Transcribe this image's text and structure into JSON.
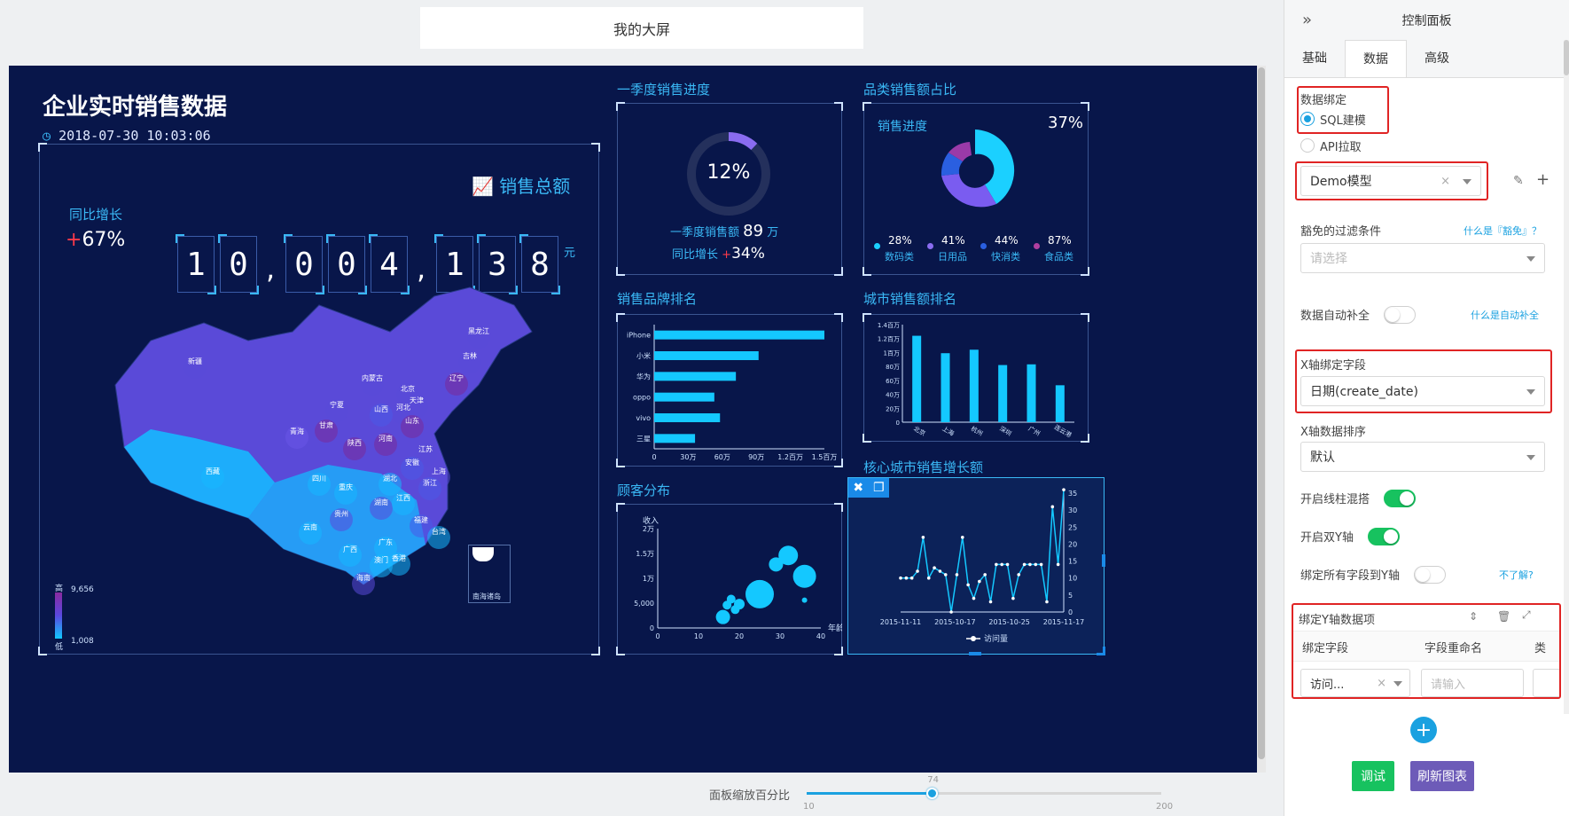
{
  "page_title": "我的大屏",
  "dashboard": {
    "title": "企业实时销售数据",
    "datetime": "2018-07-30 10:03:06",
    "sales_total": {
      "label": "销售总额",
      "yoy_label": "同比增长",
      "yoy_sign": "+",
      "yoy_value": "67%",
      "digits": [
        "1",
        "0",
        ",",
        "0",
        "0",
        "4",
        ",",
        "1",
        "3",
        "8"
      ],
      "unit": "元"
    },
    "map": {
      "provinces": [
        "新疆",
        "西藏",
        "青海",
        "甘肃",
        "内蒙古",
        "黑龙江",
        "吉林",
        "辽宁",
        "北京",
        "天津",
        "河北",
        "山西",
        "陕西",
        "宁夏",
        "山东",
        "河南",
        "江苏",
        "安徽",
        "上海",
        "浙江",
        "湖北",
        "四川",
        "重庆",
        "贵州",
        "云南",
        "湖南",
        "江西",
        "福建",
        "台湾",
        "广西",
        "广东",
        "香港",
        "澳门",
        "海南"
      ],
      "inset": "南海诸岛",
      "legend_high_label": "高",
      "legend_low_label": "低",
      "legend_max": "9,656",
      "legend_min": "1,008"
    },
    "q1": {
      "title": "一季度销售进度",
      "percent": "12%",
      "percent_value": 12,
      "amount_label": "一季度销售额",
      "amount": "89",
      "amount_unit": "万",
      "yoy_label": "同比增长",
      "yoy_sign": "+",
      "yoy": "34%"
    },
    "category": {
      "title": "品类销售额占比",
      "progress_label": "销售进度",
      "progress": "37%",
      "items": [
        {
          "pct": "28%",
          "name": "数码类",
          "color": "#1bd0ff"
        },
        {
          "pct": "41%",
          "name": "日用品",
          "color": "#8a6cf0"
        },
        {
          "pct": "44%",
          "name": "快消类",
          "color": "#2a5fe0"
        },
        {
          "pct": "87%",
          "name": "食品类",
          "color": "#b03fa0"
        }
      ]
    },
    "brand": {
      "title": "销售品牌排名"
    },
    "city": {
      "title": "城市销售额排名"
    },
    "customer": {
      "title": "顾客分布"
    },
    "growth": {
      "title": "核心城市销售增长额"
    }
  },
  "chart_data": [
    {
      "type": "bar",
      "orientation": "horizontal",
      "categories": [
        "iPhone",
        "小米",
        "华为",
        "oppo",
        "vivo",
        "三星"
      ],
      "values": [
        1.5,
        0.92,
        0.72,
        0.53,
        0.58,
        0.36
      ],
      "xticks": [
        "0",
        "30万",
        "60万",
        "90万",
        "1.2百万",
        "1.5百万"
      ],
      "xlim": [
        0,
        1.5
      ]
    },
    {
      "type": "bar",
      "categories": [
        "北京",
        "上海",
        "杭州",
        "深圳",
        "广州",
        "连云港"
      ],
      "values": [
        1.24,
        0.99,
        1.04,
        0.82,
        0.83,
        0.53
      ],
      "yticks": [
        "0",
        "20万",
        "40万",
        "60万",
        "80万",
        "1百万",
        "1.2百万",
        "1.4百万"
      ],
      "ylim": [
        0,
        1.4
      ]
    },
    {
      "type": "scatter",
      "xlabel": "年龄",
      "ylabel": "收入",
      "xlim": [
        0,
        40
      ],
      "ylim": [
        0,
        20000
      ],
      "xticks": [
        "0",
        "10",
        "20",
        "30",
        "40"
      ],
      "yticks": [
        "0",
        "5,000",
        "1万",
        "1.5万",
        "2万"
      ],
      "points": [
        [
          16,
          2200,
          8
        ],
        [
          17,
          4600,
          5
        ],
        [
          18,
          5800,
          5
        ],
        [
          19,
          3700,
          5
        ],
        [
          20,
          4800,
          6
        ],
        [
          25,
          6800,
          16
        ],
        [
          29,
          12800,
          8
        ],
        [
          32,
          14600,
          11
        ],
        [
          36,
          10400,
          13
        ],
        [
          36,
          5600,
          3
        ]
      ]
    },
    {
      "type": "line",
      "series": [
        {
          "name": "访问量",
          "values": [
            10,
            10,
            10,
            12,
            22,
            10,
            13,
            12,
            11,
            0,
            11,
            22,
            8,
            4,
            9,
            11,
            3,
            14,
            14,
            14,
            4,
            11,
            14,
            14,
            14,
            14,
            3,
            31,
            14,
            36
          ]
        }
      ],
      "ylim": [
        0,
        35
      ],
      "yticks": [
        "0",
        "5",
        "10",
        "15",
        "20",
        "25",
        "30",
        "35"
      ],
      "xticks": [
        "2015-11-11",
        "2015-10-17",
        "2015-10-25",
        "2015-11-17"
      ]
    }
  ],
  "panel": {
    "title": "控制面板",
    "tabs": [
      "基础",
      "数据",
      "高级"
    ],
    "active_tab": "数据",
    "binding_label": "数据绑定",
    "radio_sql": "SQL建模",
    "radio_api": "API拉取",
    "model_value": "Demo模型",
    "filter_label": "豁免的过滤条件",
    "filter_link": "什么是『豁免』？",
    "filter_placeholder": "请选择",
    "autofill_label": "数据自动补全",
    "autofill_link": "什么是自动补全",
    "x_field_label": "X轴绑定字段",
    "x_field_value": "日期(create_date)",
    "x_sort_label": "X轴数据排序",
    "x_sort_value": "默认",
    "mix_label": "开启线柱混搭",
    "dual_y_label": "开启双Y轴",
    "bind_all_label": "绑定所有字段到Y轴",
    "bind_all_link": "不了解?",
    "y_items_label": "绑定Y轴数据项",
    "col_field": "绑定字段",
    "col_rename": "字段重命名",
    "col_type": "类",
    "row_field_value": "访问...",
    "row_rename_placeholder": "请输入",
    "debug_btn": "调试",
    "refresh_btn": "刷新图表"
  },
  "zoom": {
    "label": "面板缩放百分比",
    "value": "74",
    "min": "10",
    "max": "200",
    "pct": 0.3556
  }
}
